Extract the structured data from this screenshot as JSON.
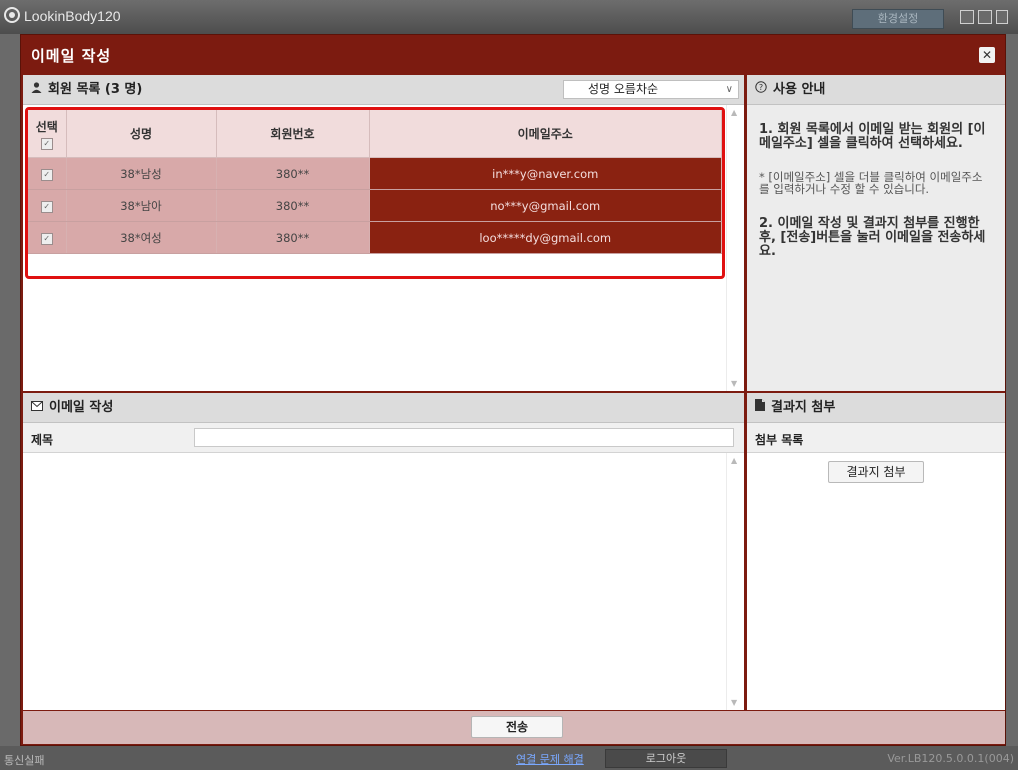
{
  "app": {
    "title": "LookinBody120",
    "settings_label": "환경설정",
    "status_left": "통신실패",
    "status_link": "연결 문제 해결",
    "logout_label": "로그아웃",
    "version": "Ver.LB120.5.0.0.1(004)"
  },
  "modal": {
    "title": "이메일 작성",
    "close_glyph": "✕"
  },
  "members": {
    "header": "회원 목록 (3 명)",
    "sort_value": "성명 오름차순",
    "columns": [
      "선택",
      "성명",
      "회원번호",
      "이메일주소"
    ],
    "rows": [
      {
        "name": "38*남성",
        "number": "380**",
        "email": "in***y@naver.com",
        "checked": true
      },
      {
        "name": "38*남아",
        "number": "380**",
        "email": "no***y@gmail.com",
        "checked": true
      },
      {
        "name": "38*여성",
        "number": "380**",
        "email": "loo*****dy@gmail.com",
        "checked": true
      }
    ]
  },
  "guide": {
    "header": "사용 안내",
    "step1": "1. 회원 목록에서 이메일 받는 회원의 [이메일주소] 셀을 클릭하여 선택하세요.",
    "note": "* [이메일주소] 셀을 더블 클릭하여 이메일주소를 입력하거나 수정 할 수 있습니다.",
    "step2": "2. 이메일 작성 및 결과지 첨부를 진행한 후, [전송]버튼을 눌러 이메일을 전송하세요."
  },
  "compose": {
    "header": "이메일 작성",
    "subject_label": "제목",
    "subject_value": ""
  },
  "attach": {
    "header": "결과지 첨부",
    "list_label": "첨부 목록",
    "button_label": "결과지 첨부"
  },
  "footer": {
    "send_label": "전송"
  },
  "icons": {
    "member_icon": "person-icon",
    "guide_icon": "question-circle-icon",
    "compose_icon": "envelope-icon",
    "attach_icon": "document-icon"
  },
  "colors": {
    "modal_bg": "#7c1b10",
    "highlight_border": "#e01010",
    "email_cell": "#8a2211",
    "row_cell": "#d8a9a9"
  }
}
